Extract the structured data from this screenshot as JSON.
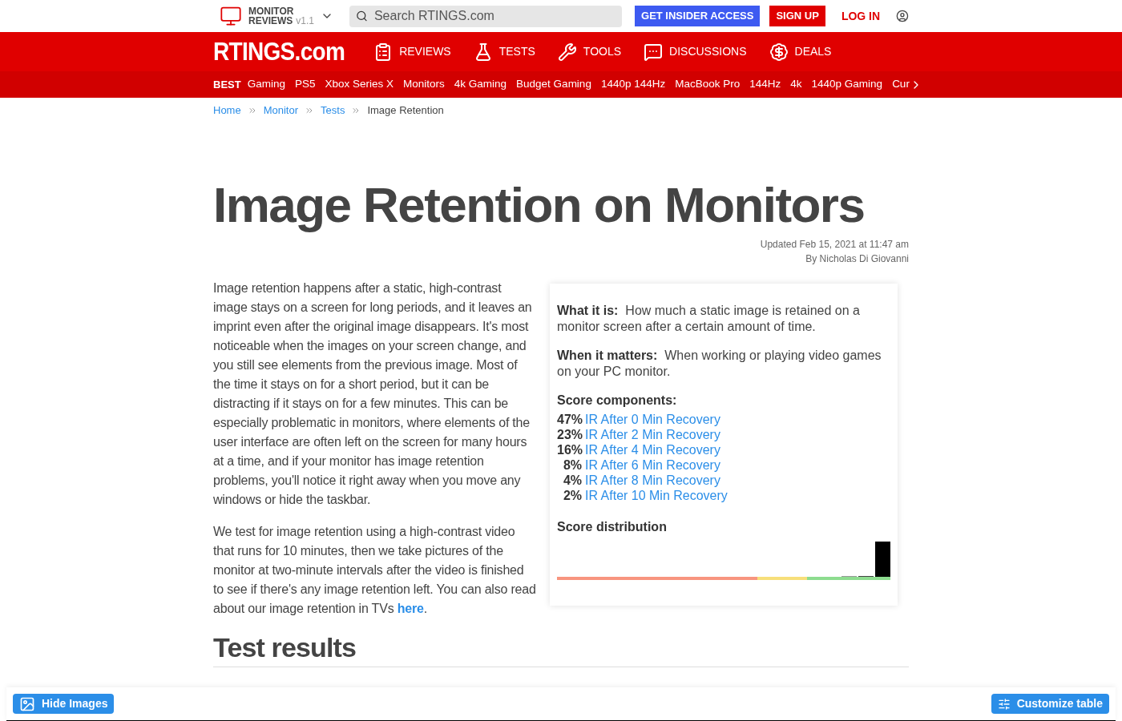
{
  "top_bar": {
    "product": {
      "line1": "MONITOR",
      "line2": "REVIEWS",
      "version": "v1.1"
    },
    "search": {
      "placeholder": "Search RTINGS.com"
    },
    "insider_button": "GET INSIDER ACCESS",
    "signup_button": "SIGN UP",
    "login_link": "LOG IN"
  },
  "main_nav": {
    "logo": "RTINGS.com",
    "items": [
      {
        "label": "REVIEWS",
        "kind": "reviews"
      },
      {
        "label": "TESTS",
        "kind": "tests"
      },
      {
        "label": "TOOLS",
        "kind": "tools"
      },
      {
        "label": "DISCUSSIONS",
        "kind": "discussions"
      },
      {
        "label": "DEALS",
        "kind": "deals"
      }
    ]
  },
  "best_bar": {
    "label": "BEST",
    "items": [
      "Gaming",
      "PS5",
      "Xbox Series X",
      "Monitors",
      "4k Gaming",
      "Budget Gaming",
      "1440p 144Hz",
      "MacBook Pro",
      "144Hz",
      "4k",
      "1440p Gaming",
      "Cur"
    ]
  },
  "breadcrumbs": {
    "links": [
      "Home",
      "Monitor",
      "Tests"
    ],
    "current": "Image Retention"
  },
  "title": "Image Retention on Monitors",
  "updated": "Updated Feb 15, 2021 at 11:47 am",
  "author": "By Nicholas Di Giovanni",
  "paragraphs": [
    "Image retention happens after a static, high-contrast image stays on a screen for long periods, and it leaves an imprint even after the original image disappears. It's most noticeable when the images on your screen change, and you still see elements from the previous image. Most of the time it stays on for a short period, but it can be distracting if it stays on for a few minutes. This can be especially problematic in monitors, where elements of the user interface are often left on the screen for many hours at a time, and if your monitor has image retention problems, you'll notice it right away when you move any windows or hide the taskbar."
  ],
  "last_paragraph": {
    "text": "We test for image retention using a high-contrast video that runs for 10 minutes, then we take pictures of the monitor at two-minute intervals after the video is finished to see if there's any image retention left. You can also read about our image retention in TVs",
    "link": "here",
    "end": "."
  },
  "info_card": {
    "what_label": "What it is:",
    "what_text": "How much a static image is retained on a monitor screen after a certain amount of time.",
    "when_label": "When it matters:",
    "when_text": "When working or playing video games on your PC monitor.",
    "components_heading": "Score components:",
    "components": [
      {
        "percent": "47%",
        "name": "IR After 0 Min Recovery"
      },
      {
        "percent": "23%",
        "name": "IR After 2 Min Recovery"
      },
      {
        "percent": "16%",
        "name": "IR After 4 Min Recovery"
      },
      {
        "percent": "8%",
        "name": "IR After 6 Min Recovery"
      },
      {
        "percent": "4%",
        "name": "IR After 8 Min Recovery"
      },
      {
        "percent": "2%",
        "name": "IR After 10 Min Recovery"
      }
    ],
    "distribution_heading": "Score distribution"
  },
  "section_heading": "Test results",
  "bottom_bar": {
    "hide_images": "Hide Images",
    "customize": "Customize table"
  }
}
